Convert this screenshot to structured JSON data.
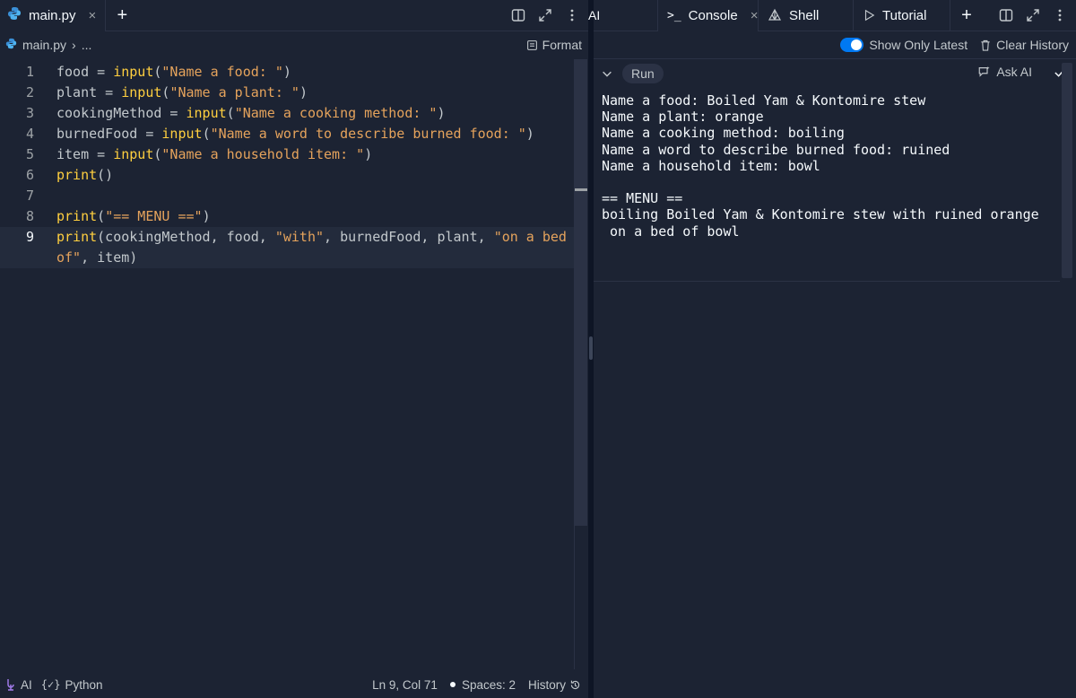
{
  "editor": {
    "tab": {
      "label": "main.py",
      "close": "×",
      "add": "+"
    },
    "breadcrumb": {
      "file": "main.py",
      "separator": "›",
      "more": "..."
    },
    "format_label": "Format",
    "lines": [
      {
        "n": "1",
        "parts": [
          [
            "t",
            "food = "
          ],
          [
            "fn",
            "input"
          ],
          [
            "t",
            "("
          ],
          [
            "str",
            "\"Name a food: \""
          ],
          [
            "t",
            ")"
          ]
        ]
      },
      {
        "n": "2",
        "parts": [
          [
            "t",
            "plant = "
          ],
          [
            "fn",
            "input"
          ],
          [
            "t",
            "("
          ],
          [
            "str",
            "\"Name a plant: \""
          ],
          [
            "t",
            ")"
          ]
        ]
      },
      {
        "n": "3",
        "parts": [
          [
            "t",
            "cookingMethod = "
          ],
          [
            "fn",
            "input"
          ],
          [
            "t",
            "("
          ],
          [
            "str",
            "\"Name a cooking method: \""
          ],
          [
            "t",
            ")"
          ]
        ]
      },
      {
        "n": "4",
        "parts": [
          [
            "t",
            "burnedFood = "
          ],
          [
            "fn",
            "input"
          ],
          [
            "t",
            "("
          ],
          [
            "str",
            "\"Name a word to describe burned food: \""
          ],
          [
            "t",
            ")"
          ]
        ]
      },
      {
        "n": "5",
        "parts": [
          [
            "t",
            "item = "
          ],
          [
            "fn",
            "input"
          ],
          [
            "t",
            "("
          ],
          [
            "str",
            "\"Name a household item: \""
          ],
          [
            "t",
            ")"
          ]
        ]
      },
      {
        "n": "6",
        "parts": [
          [
            "fn",
            "print"
          ],
          [
            "t",
            "()"
          ]
        ]
      },
      {
        "n": "7",
        "parts": []
      },
      {
        "n": "8",
        "parts": [
          [
            "fn",
            "print"
          ],
          [
            "t",
            "("
          ],
          [
            "str",
            "\"== MENU ==\""
          ],
          [
            "t",
            ")"
          ]
        ]
      },
      {
        "n": "9",
        "active": true,
        "parts": [
          [
            "fn",
            "print"
          ],
          [
            "t",
            "(cookingMethod, food, "
          ],
          [
            "str",
            "\"with\""
          ],
          [
            "t",
            ", burnedFood, plant, "
          ],
          [
            "str",
            "\"on a bed of\""
          ],
          [
            "t",
            ", item)"
          ]
        ]
      }
    ],
    "status": {
      "ai": "AI",
      "language": "Python",
      "position": "Ln 9, Col 71",
      "spaces": "Spaces: 2",
      "history": "History"
    }
  },
  "console": {
    "tabs": {
      "ai": "AI",
      "console": "Console",
      "shell": "Shell",
      "tutorial": "Tutorial",
      "close": "×",
      "add": "+"
    },
    "toolbar": {
      "show_only_latest": "Show Only Latest",
      "clear_history": "Clear History"
    },
    "run": {
      "label": "Run",
      "ask_ai": "Ask AI"
    },
    "output": "Name a food: Boiled Yam & Kontomire stew\nName a plant: orange\nName a cooking method: boiling\nName a word to describe burned food: ruined\nName a household item: bowl\n\n== MENU ==\nboiling Boiled Yam & Kontomire stew with ruined orange\n on a bed of bowl"
  },
  "colors": {
    "background": "#1c2333",
    "function": "#ffcf3f",
    "string": "#e5a35c",
    "accent": "#0079f2"
  }
}
